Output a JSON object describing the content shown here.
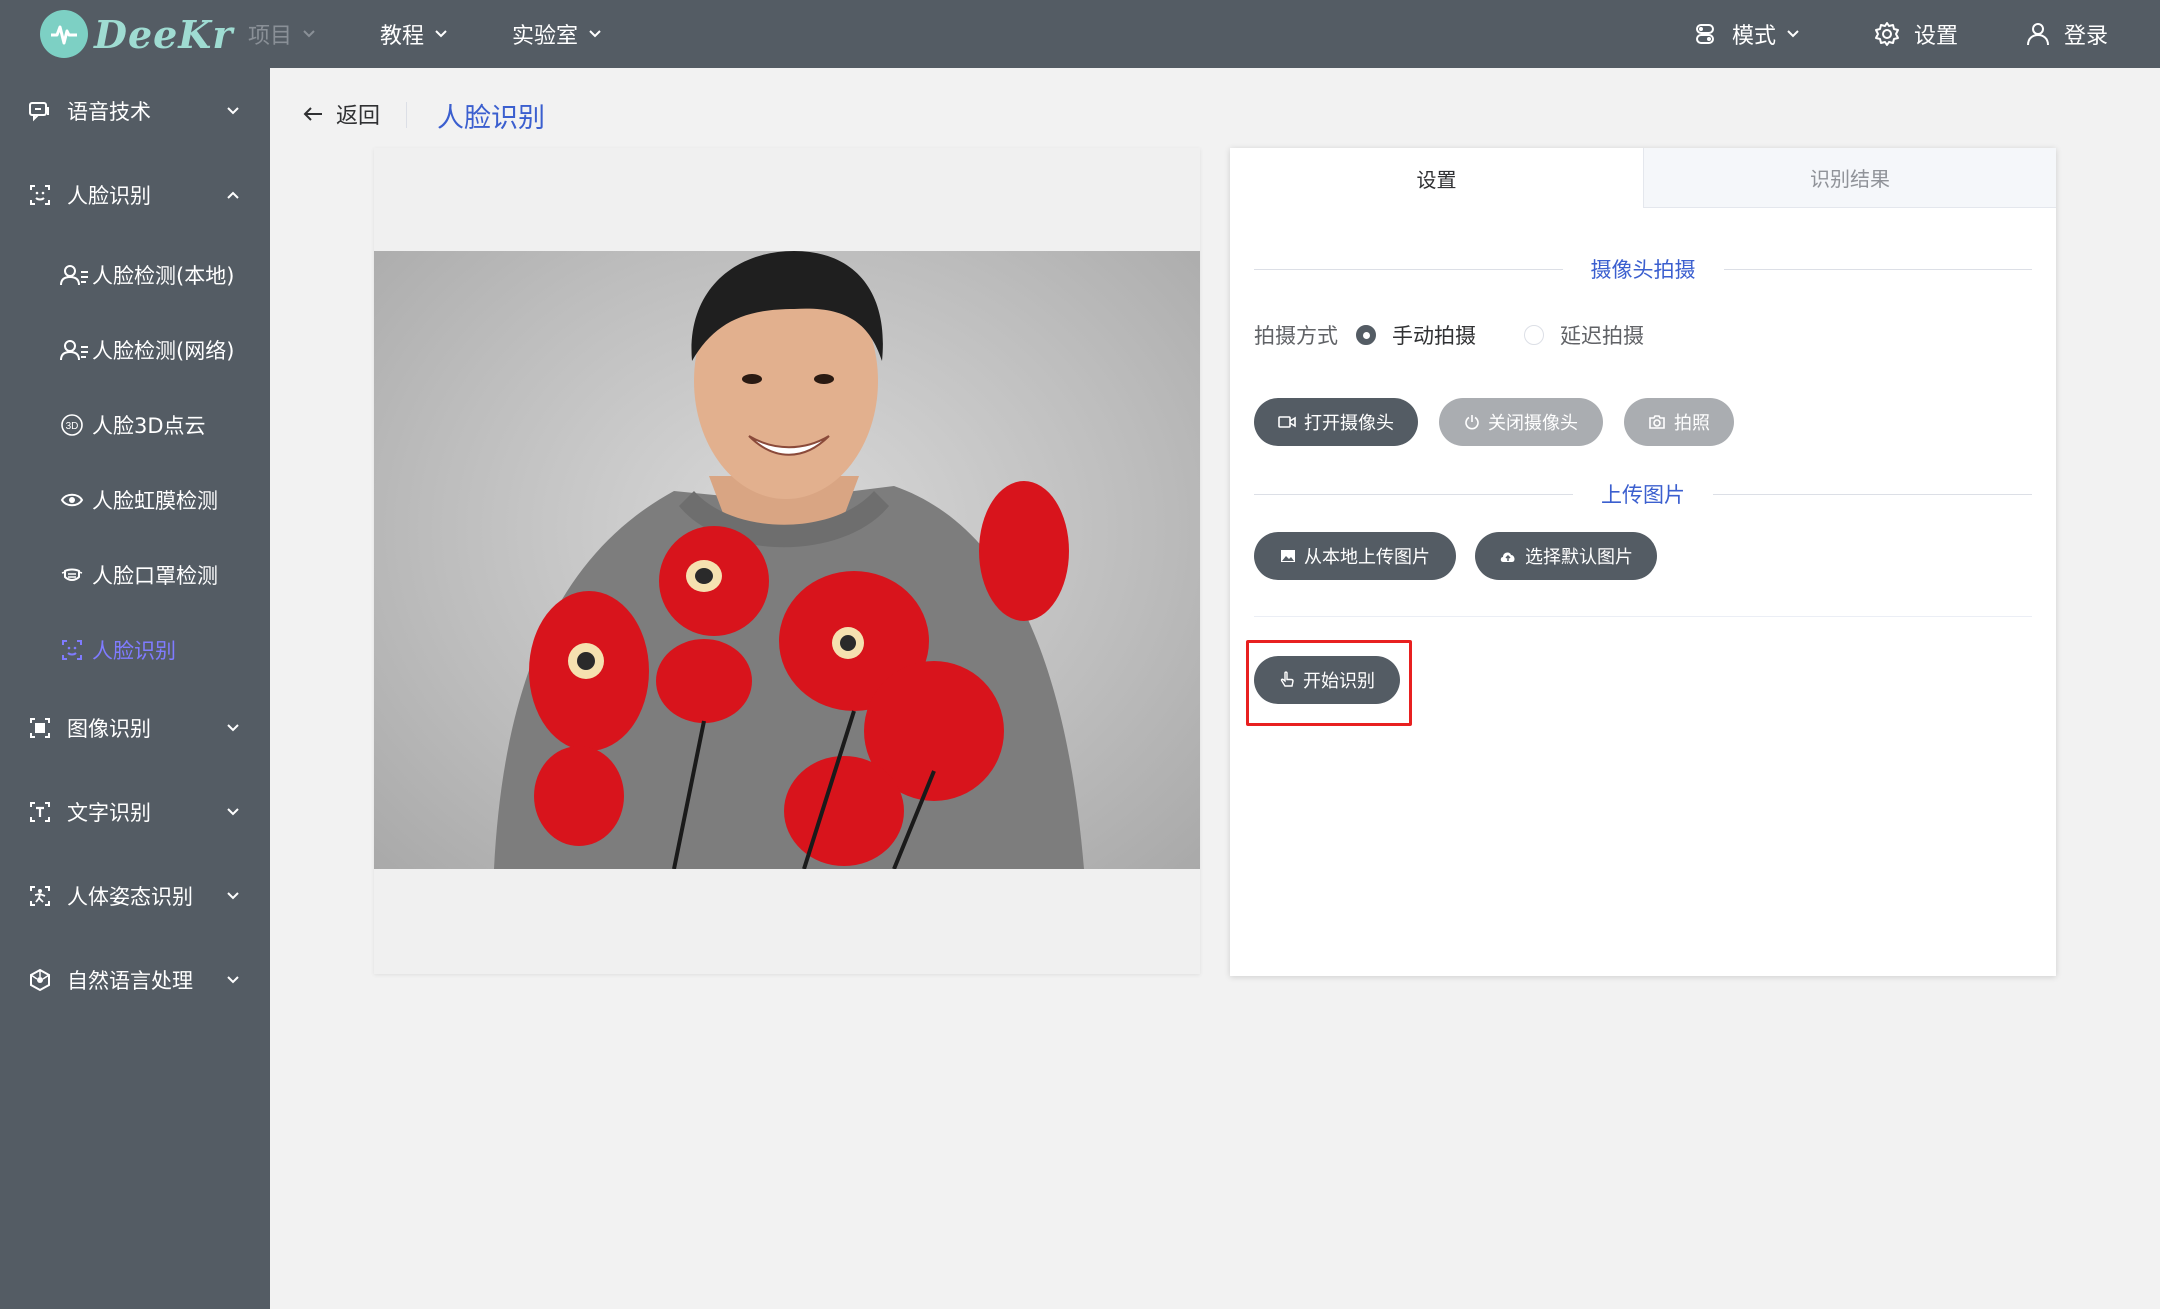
{
  "header": {
    "logo_text": "DeeKr",
    "nav": [
      {
        "label": "项目"
      },
      {
        "label": "教程"
      },
      {
        "label": "实验室"
      }
    ],
    "mode_label": "模式",
    "settings_label": "设置",
    "login_label": "登录"
  },
  "sidebar": {
    "items": [
      {
        "label": "语音技术",
        "icon": "speech-icon",
        "expanded": false
      },
      {
        "label": "人脸识别",
        "icon": "face-icon",
        "expanded": true
      },
      {
        "label": "人脸检测(本地)",
        "icon": "face-detect-icon"
      },
      {
        "label": "人脸检测(网络)",
        "icon": "face-detect-icon"
      },
      {
        "label": "人脸3D点云",
        "icon": "3d-icon"
      },
      {
        "label": "人脸虹膜检测",
        "icon": "eye-icon"
      },
      {
        "label": "人脸口罩检测",
        "icon": "mask-icon"
      },
      {
        "label": "人脸识别",
        "icon": "face-icon",
        "active": true
      },
      {
        "label": "图像识别",
        "icon": "image-scan-icon",
        "expanded": false
      },
      {
        "label": "文字识别",
        "icon": "text-scan-icon",
        "expanded": false
      },
      {
        "label": "人体姿态识别",
        "icon": "pose-icon",
        "expanded": false
      },
      {
        "label": "自然语言处理",
        "icon": "nlp-icon",
        "expanded": false
      }
    ]
  },
  "page": {
    "back_label": "返回",
    "title": "人脸识别"
  },
  "tabs": [
    {
      "label": "设置",
      "active": true
    },
    {
      "label": "识别结果",
      "active": false
    }
  ],
  "camera_section": {
    "title": "摄像头拍摄",
    "mode_label": "拍摄方式",
    "options": [
      {
        "label": "手动拍摄",
        "checked": true
      },
      {
        "label": "延迟拍摄",
        "checked": false
      }
    ],
    "buttons": [
      {
        "label": "打开摄像头",
        "enabled": true
      },
      {
        "label": "关闭摄像头",
        "enabled": false
      },
      {
        "label": "拍照",
        "enabled": false
      }
    ]
  },
  "upload_section": {
    "title": "上传图片",
    "buttons": [
      {
        "label": "从本地上传图片"
      },
      {
        "label": "选择默认图片"
      }
    ]
  },
  "start_button_label": "开始识别",
  "colors": {
    "header_bg": "#545c64",
    "accent": "#3b5fcf",
    "sidebar_active": "#7f7bff",
    "highlight_border": "#e82020"
  }
}
